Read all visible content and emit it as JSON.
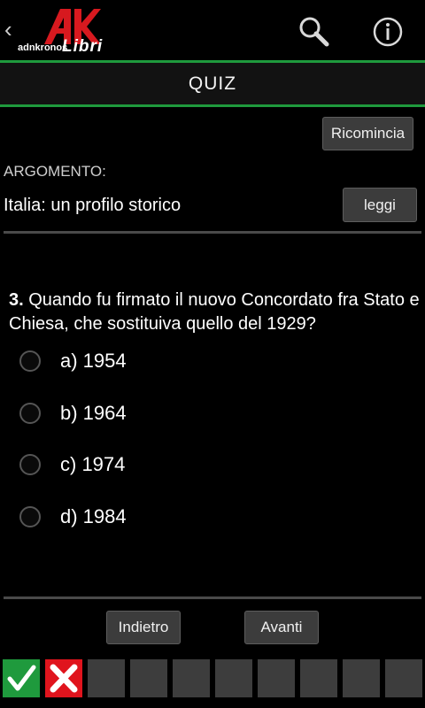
{
  "header": {
    "back_glyph": "‹",
    "logo_small": "adnkronos",
    "logo_big": "Libri",
    "icons": [
      "back-icon",
      "logo-mark",
      "search-icon",
      "info-icon"
    ]
  },
  "title_bar": {
    "title": "QUIZ"
  },
  "toolbar": {
    "restart_label": "Ricomincia",
    "read_label": "leggi"
  },
  "topic": {
    "label": "ARGOMENTO:",
    "value": "Italia: un profilo storico"
  },
  "question": {
    "number": "3.",
    "text": "Quando fu firmato il nuovo Concordato fra Stato e Chiesa, che sostituiva quello del 1929?"
  },
  "options": [
    {
      "label": "a) 1954",
      "selected": false
    },
    {
      "label": "b) 1964",
      "selected": false
    },
    {
      "label": "c) 1974",
      "selected": false
    },
    {
      "label": "d) 1984",
      "selected": false
    }
  ],
  "navigation": {
    "back_label": "Indietro",
    "next_label": "Avanti"
  },
  "progress": {
    "cells": [
      "correct",
      "wrong",
      "empty",
      "empty",
      "empty",
      "empty",
      "empty",
      "empty",
      "empty",
      "empty"
    ],
    "correct_icon": "check-icon",
    "wrong_icon": "cross-icon"
  },
  "colors": {
    "accent_green": "#1f9a3d",
    "error_red": "#e0141d",
    "logo_red": "#d7191f",
    "background": "#000000",
    "button": "#3c3c3c"
  }
}
